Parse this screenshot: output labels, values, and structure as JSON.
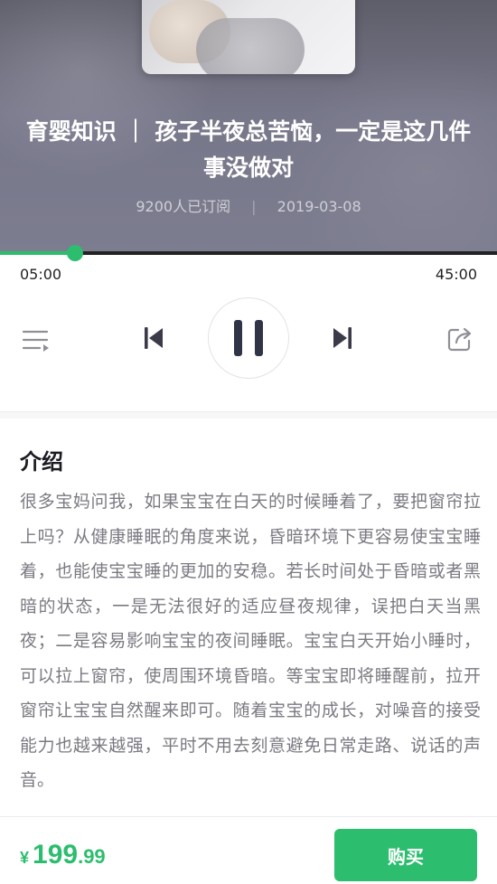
{
  "hero": {
    "title": "育婴知识 ｜ 孩子半夜总苦恼，一定是这几件事没做对",
    "subscribers": "9200人已订阅",
    "meta_separator": "|",
    "date": "2019-03-08"
  },
  "player": {
    "current_time": "05:00",
    "total_time": "45:00",
    "progress_fraction": 0.15,
    "icons": {
      "playlist": "playlist-icon",
      "previous": "skip-previous-icon",
      "pause": "pause-icon",
      "next": "skip-next-icon",
      "share": "share-icon"
    }
  },
  "intro": {
    "heading": "介绍",
    "body": "很多宝妈问我，如果宝宝在白天的时候睡着了，要把窗帘拉上吗？从健康睡眠的角度来说，昏暗环境下更容易使宝宝睡着，也能使宝宝睡的更加的安稳。若长时间处于昏暗或者黑暗的状态，一是无法很好的适应昼夜规律，误把白天当黑夜；二是容易影响宝宝的夜间睡眠。宝宝白天开始小睡时，可以拉上窗帘，使周围环境昏暗。等宝宝即将睡醒前，拉开窗帘让宝宝自然醒来即可。随着宝宝的成长，对噪音的接受能力也越来越强，平时不用去刻意避免日常走路、说话的声音。"
  },
  "purchase": {
    "currency": "¥",
    "price_int": "199",
    "price_dec": ".99",
    "buy_label": "购买"
  },
  "colors": {
    "accent": "#2dbd6e",
    "text_dark": "#1b1b22",
    "text_body": "#7a7a82"
  }
}
